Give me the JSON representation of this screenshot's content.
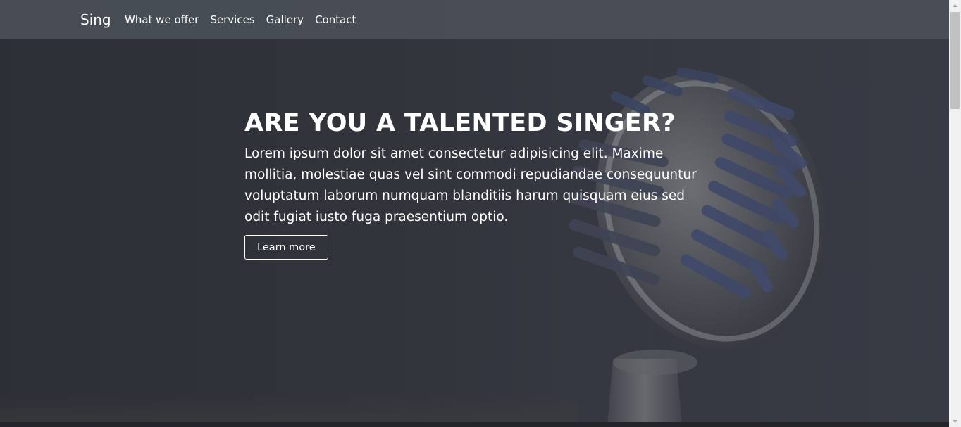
{
  "navbar": {
    "brand": "Sing",
    "links": [
      "What we offer",
      "Services",
      "Gallery",
      "Contact"
    ]
  },
  "hero": {
    "headline": "ARE YOU A TALENTED SINGER?",
    "lead": "Lorem ipsum dolor sit amet consectetur adipisicing elit. Maxime mollitia, molestiae quas vel sint commodi repudiandae consequuntur voluptatum laborum numquam blanditiis harum quisquam eius sed odit fugiat iusto fuga praesentium optio.",
    "cta_label": "Learn more",
    "background_image": "microphone-image"
  },
  "colors": {
    "navbar_bg": "#4a4f58",
    "hero_bg": "#34373e",
    "text": "#ffffff",
    "button_border": "#ffffff"
  },
  "icons": {
    "scroll_up": "chevron-up-icon",
    "scroll_down": "chevron-down-icon"
  }
}
